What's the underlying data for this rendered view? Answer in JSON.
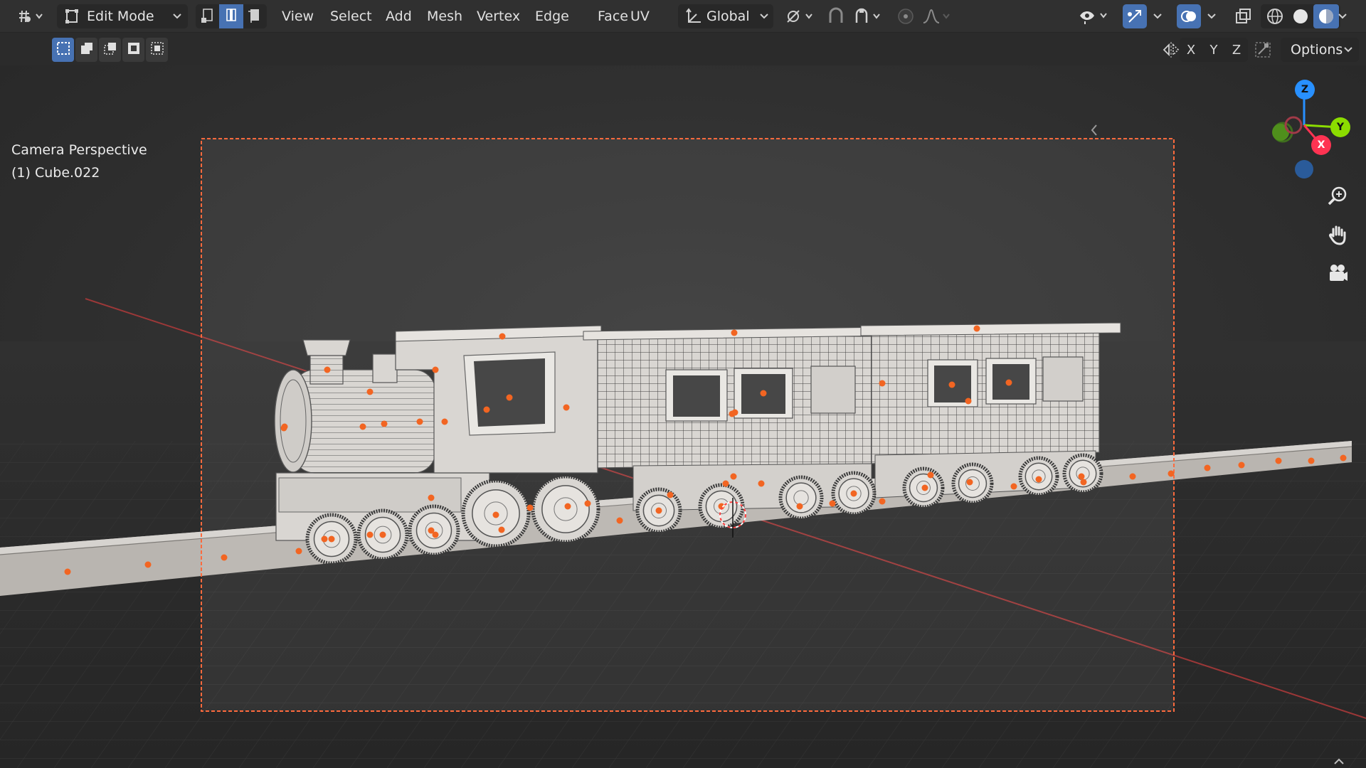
{
  "header": {
    "mode_label": "Edit Mode",
    "menus": [
      "View",
      "Select",
      "Add",
      "Mesh",
      "Vertex",
      "Edge",
      "Face",
      "UV"
    ],
    "orientation_label": "Global"
  },
  "tool_header": {
    "axis_labels": [
      "X",
      "Y",
      "Z"
    ],
    "options_label": "Options"
  },
  "viewport": {
    "view_name": "Camera Perspective",
    "active_object": "(1) Cube.022"
  },
  "gizmo": {
    "z_label": "Z",
    "y_label": "Y",
    "x_label": "X"
  },
  "colors": {
    "accent_blue": "#4772b3",
    "camera_frame": "#ff6a3d",
    "vertex": "#f26522",
    "axis_x": "#ff3352",
    "axis_y": "#8bdc00",
    "axis_z": "#2890ff",
    "model_base": "#d9d6d2"
  },
  "icons": {
    "editor_type": "editor-type-icon",
    "edit_mode": "edit-mode-icon",
    "vertex_select": "vertex-select-icon",
    "edge_select": "edge-select-icon",
    "face_select": "face-select-icon",
    "transform_orientation": "transform-orientation-icon",
    "pivot": "pivot-point-icon",
    "snap": "snap-icon",
    "proportional": "proportional-editing-icon",
    "visibility": "eye-icon",
    "gizmo_toggle": "gizmo-icon",
    "overlays": "overlays-icon",
    "xray": "xray-icon",
    "shading": [
      "wireframe-shading-icon",
      "solid-shading-icon",
      "material-shading-icon"
    ],
    "navigation": [
      "zoom-icon",
      "pan-hand-icon",
      "camera-view-icon"
    ]
  }
}
